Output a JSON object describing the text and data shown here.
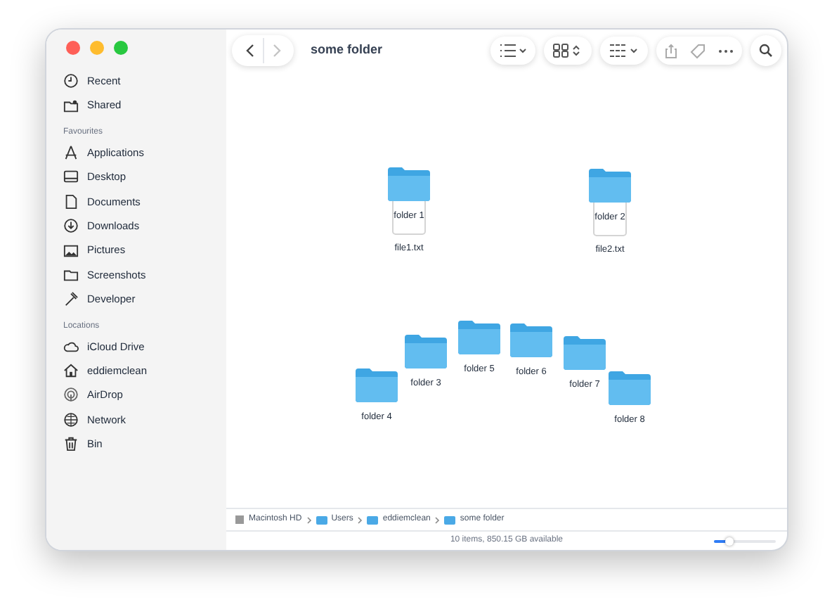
{
  "window": {
    "title": "some folder"
  },
  "navigation": [
    {
      "kind": "back",
      "disabled": false
    },
    {
      "kind": "forward",
      "disabled": true
    }
  ],
  "sidebar": {
    "top_items": [
      {
        "label": "Recent",
        "kind": "clock"
      },
      {
        "label": "Shared",
        "kind": "shared"
      }
    ],
    "sections": [
      {
        "header": "Favourites",
        "items": [
          {
            "label": "Applications",
            "kind": "apps"
          },
          {
            "label": "Desktop",
            "kind": "desktop"
          },
          {
            "label": "Documents",
            "kind": "doc"
          },
          {
            "label": "Downloads",
            "kind": "download"
          },
          {
            "label": "Pictures",
            "kind": "picture"
          },
          {
            "label": "Screenshots",
            "kind": "folder"
          },
          {
            "label": "Developer",
            "kind": "hammer"
          }
        ]
      },
      {
        "header": "Locations",
        "items": [
          {
            "label": "iCloud Drive",
            "kind": "cloud"
          },
          {
            "label": "eddiemclean",
            "kind": "home"
          },
          {
            "label": "AirDrop",
            "kind": "airdrop"
          },
          {
            "label": "Network",
            "kind": "globe"
          },
          {
            "label": "Bin",
            "kind": "bin"
          }
        ]
      }
    ]
  },
  "items": [
    {
      "kind": "folder",
      "name": "folder 1"
    },
    {
      "kind": "file",
      "name": "file1.txt"
    },
    {
      "kind": "folder",
      "name": "folder 2"
    },
    {
      "kind": "file",
      "name": "file2.txt"
    },
    {
      "kind": "folder",
      "name": "folder 3"
    },
    {
      "kind": "folder",
      "name": "folder 4"
    },
    {
      "kind": "folder",
      "name": "folder 5"
    },
    {
      "kind": "folder",
      "name": "folder 6"
    },
    {
      "kind": "folder",
      "name": "folder 7"
    },
    {
      "kind": "folder",
      "name": "folder 8"
    }
  ],
  "path_bar": [
    {
      "label": "Macintosh HD",
      "kind": "disk"
    },
    {
      "label": "Users",
      "kind": "folder"
    },
    {
      "label": "eddiemclean",
      "kind": "folder"
    },
    {
      "label": "some folder",
      "kind": "folder"
    }
  ],
  "status_bar": {
    "text": "10 items, 850.15 GB available",
    "zoom_slider": {
      "level": 0.25
    }
  }
}
